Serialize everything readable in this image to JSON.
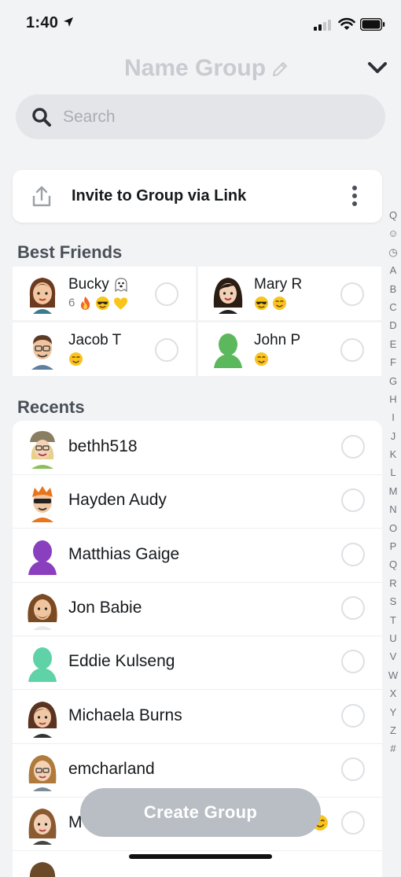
{
  "status_bar": {
    "time": "1:40"
  },
  "header": {
    "title": "Name Group"
  },
  "search": {
    "placeholder": "Search"
  },
  "invite": {
    "label": "Invite to Group via Link"
  },
  "best_friends": {
    "title": "Best Friends",
    "items": [
      {
        "name": "Bucky",
        "sub": "6"
      },
      {
        "name": "Mary R",
        "sub": ""
      },
      {
        "name": "Jacob T",
        "sub": ""
      },
      {
        "name": "John P",
        "sub": ""
      }
    ]
  },
  "recents": {
    "title": "Recents",
    "items": [
      {
        "name": "bethh518"
      },
      {
        "name": "Hayden Audy"
      },
      {
        "name": "Matthias Gaige"
      },
      {
        "name": "Jon Babie"
      },
      {
        "name": "Eddie Kulseng"
      },
      {
        "name": "Michaela Burns"
      },
      {
        "name": "emcharland"
      },
      {
        "name": "M"
      }
    ]
  },
  "alphabet": [
    "Q",
    "☺",
    "◷",
    "A",
    "B",
    "C",
    "D",
    "E",
    "F",
    "G",
    "H",
    "I",
    "J",
    "K",
    "L",
    "M",
    "N",
    "O",
    "P",
    "Q",
    "R",
    "S",
    "T",
    "U",
    "V",
    "W",
    "X",
    "Y",
    "Z",
    "#"
  ],
  "create_button": {
    "label": "Create Group"
  },
  "colors": {
    "ghost_purple": "#8a3fbf",
    "ghost_green": "#5cb85c",
    "ghost_teal": "#5fd3a7",
    "button_gray": "#b9bdc4"
  }
}
